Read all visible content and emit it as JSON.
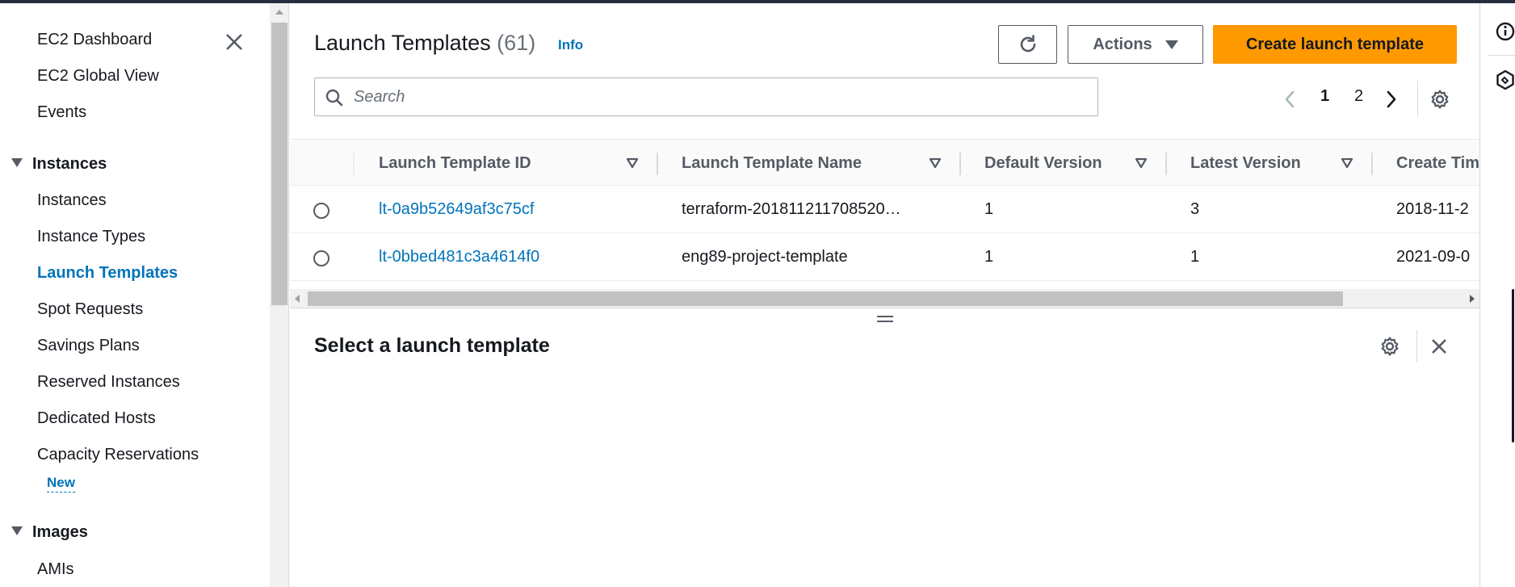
{
  "sidebar": {
    "items_top": [
      {
        "label": "EC2 Dashboard"
      },
      {
        "label": "EC2 Global View"
      },
      {
        "label": "Events"
      }
    ],
    "section_instances": {
      "label": "Instances"
    },
    "instances_items": [
      {
        "label": "Instances"
      },
      {
        "label": "Instance Types"
      },
      {
        "label": "Launch Templates",
        "active": true
      },
      {
        "label": "Spot Requests"
      },
      {
        "label": "Savings Plans"
      },
      {
        "label": "Reserved Instances"
      },
      {
        "label": "Dedicated Hosts"
      },
      {
        "label": "Capacity Reservations"
      }
    ],
    "new_badge": "New",
    "section_images": {
      "label": "Images"
    },
    "images_items": [
      {
        "label": "AMIs"
      }
    ]
  },
  "header": {
    "title": "Launch Templates",
    "count": "(61)",
    "info_link": "Info",
    "actions_label": "Actions",
    "create_label": "Create launch template"
  },
  "search": {
    "placeholder": "Search",
    "value": ""
  },
  "pagination": {
    "pages": [
      "1",
      "2"
    ],
    "current": "1"
  },
  "table": {
    "columns": [
      {
        "label": "Launch Template ID"
      },
      {
        "label": "Launch Template Name"
      },
      {
        "label": "Default Version"
      },
      {
        "label": "Latest Version"
      },
      {
        "label": "Create Tim"
      }
    ],
    "rows": [
      {
        "id": "lt-0a9b52649af3c75cf",
        "name": "terraform-201811211708520…",
        "default_version": "1",
        "latest_version": "3",
        "create_time": "2018-11-2"
      },
      {
        "id": "lt-0bbed481c3a4614f0",
        "name": "eng89-project-template",
        "default_version": "1",
        "latest_version": "1",
        "create_time": "2021-09-0"
      }
    ]
  },
  "detail": {
    "title": "Select a launch template"
  },
  "icons": {
    "close": "close-icon",
    "refresh": "refresh-icon",
    "search": "search-icon",
    "settings": "gear-icon",
    "info": "info-icon",
    "hexagon": "hexagon-icon"
  },
  "colors": {
    "link": "#0073bb",
    "primary_button": "#ff9900",
    "text": "#16191f",
    "muted": "#545b64"
  }
}
